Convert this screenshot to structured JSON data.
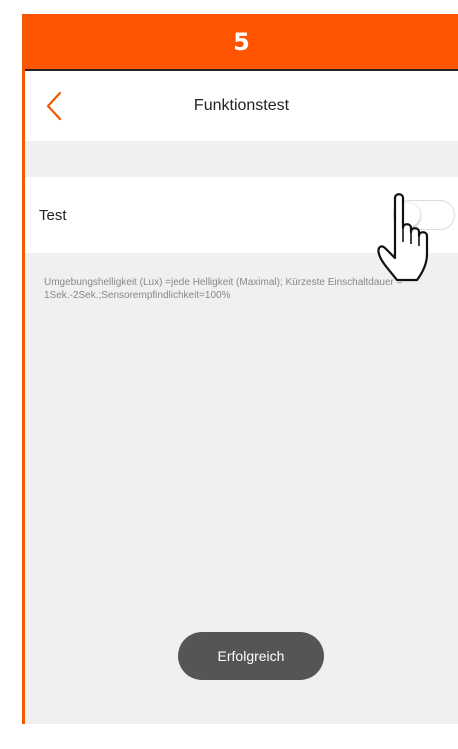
{
  "step": {
    "number": "5",
    "color": "#ff5500"
  },
  "nav": {
    "title": "Funktionstest",
    "back_icon": "chevron-left-icon",
    "accent": "#f05a00"
  },
  "test_row": {
    "label": "Test",
    "toggle_on": false
  },
  "description": "Umgebungshelligkeit (Lux) =jede Helligkeit (Maximal); Kürzeste Einschaltdauer = 1Sek.-2Sek.;Sensorempfindlichkeit=100%",
  "toast": {
    "text": "Erfolgreich"
  },
  "overlay_icon": "pointing-hand-icon"
}
